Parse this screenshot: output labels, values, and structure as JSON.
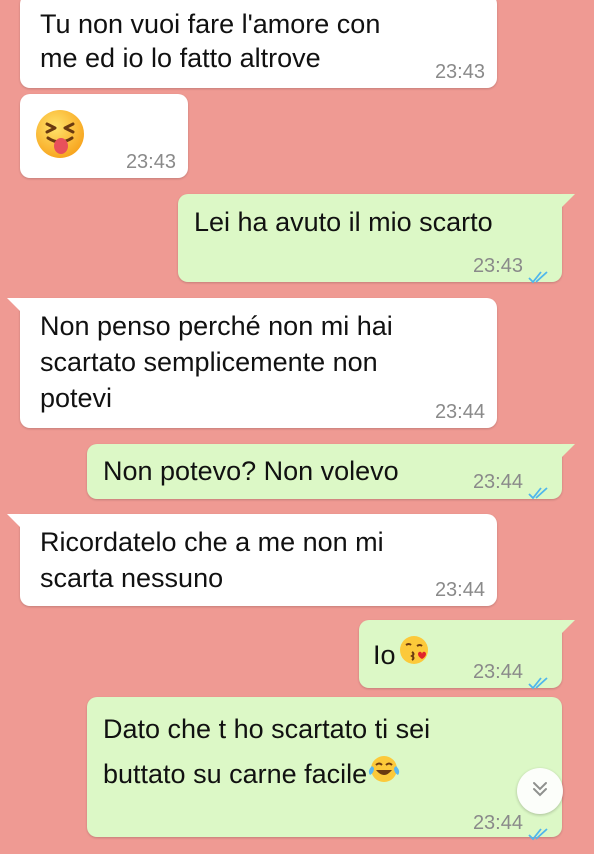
{
  "chat": {
    "messages": [
      {
        "direction": "incoming",
        "lines": [
          "Tu non vuoi fare l'amore con",
          "me ed io lo fatto altrove"
        ],
        "time": "23:43"
      },
      {
        "direction": "incoming",
        "emoji": "squinting-face-with-tongue",
        "time": "23:43"
      },
      {
        "direction": "outgoing",
        "lines": [
          "Lei ha avuto il mio scarto"
        ],
        "time": "23:43",
        "status": "read"
      },
      {
        "direction": "incoming",
        "lines": [
          "Non penso perché non mi hai",
          "scartato semplicemente non",
          "potevi"
        ],
        "time": "23:44"
      },
      {
        "direction": "outgoing",
        "lines": [
          "Non potevo? Non volevo"
        ],
        "time": "23:44",
        "status": "read"
      },
      {
        "direction": "incoming",
        "lines": [
          "Ricordatelo che a me non mi",
          "scarta nessuno"
        ],
        "time": "23:44"
      },
      {
        "direction": "outgoing",
        "lines": [
          "Io"
        ],
        "emoji": "face-blowing-a-kiss",
        "time": "23:44",
        "status": "read"
      },
      {
        "direction": "outgoing",
        "lines": [
          "Dato che t ho scartato ti sei",
          "buttato su carne facile"
        ],
        "emoji": "face-with-tears-of-joy",
        "time": "23:44",
        "status": "read"
      }
    ]
  },
  "colors": {
    "chat_background": "#ef9a93",
    "incoming_bubble": "#ffffff",
    "outgoing_bubble": "#dcf8c6",
    "read_ticks": "#4fb6ec",
    "timestamp": "#8a8a8a"
  },
  "icons": {
    "read_receipt": "double-check-icon",
    "scroll_down": "chevron-double-down-icon"
  }
}
